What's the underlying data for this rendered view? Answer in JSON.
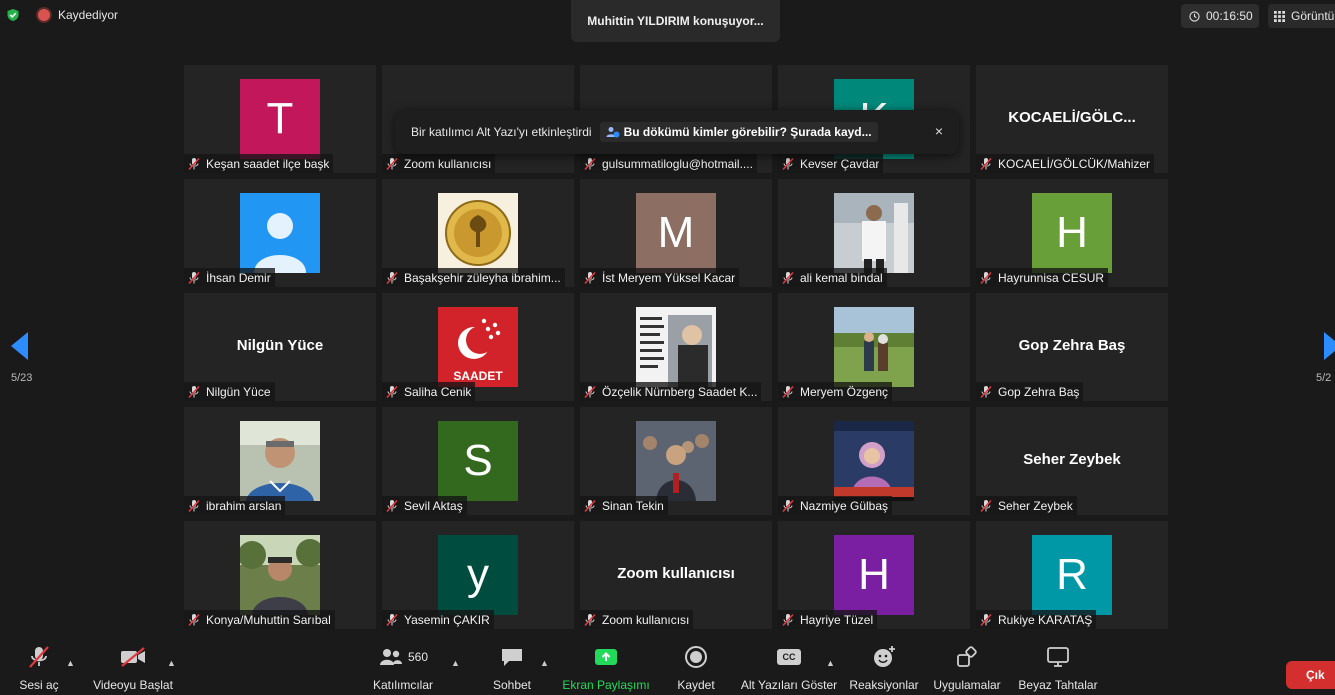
{
  "topbar": {
    "recording_label": "Kaydediyor",
    "speaker": "Muhittin YILDIRIM konuşuyor...",
    "timer": "00:16:50",
    "view_label": "Görüntü"
  },
  "toast": {
    "message": "Bir katılımcı Alt Yazı'yı etkinleştirdi",
    "link": "Bu dökümü kimler görebilir? Şurada kayd...",
    "close": "×"
  },
  "pagination": {
    "left": "5/23",
    "right": "5/2"
  },
  "colors": {
    "recording": "#d9534f",
    "share_green": "#23d959",
    "leave_red": "#d32f2f",
    "muted_red": "#e0383e"
  },
  "tiles": [
    {
      "name": "Keşan saadet ilçe başk",
      "initial": "T",
      "color": "#c2185b"
    },
    {
      "name": "Zoom kullanıcısı",
      "bigname": "Zoom kullanıcısı"
    },
    {
      "name": "gulsummatiloglu@hotmail....",
      "bigname": "gulsummatiloglu"
    },
    {
      "name": "Kevser Çavdar",
      "initial": "K",
      "color": "#00897b"
    },
    {
      "name": "KOCAELİ/GÖLCÜK/Mahizer",
      "bigname": "KOCAELİ/GÖLC..."
    },
    {
      "name": "İhsan Demir",
      "avatar": "default-avatar"
    },
    {
      "name": "Başakşehir züleyha ibrahim...",
      "avatar": "mpac-logo"
    },
    {
      "name": "İst Meryem Yüksel Kacar",
      "initial": "M",
      "color": "#8d6e63"
    },
    {
      "name": "ali kemal bindal",
      "avatar": "photo-person"
    },
    {
      "name": "Hayrunnisa CESUR",
      "initial": "H",
      "color": "#689f38"
    },
    {
      "name": "Nilgün Yüce",
      "bigname": "Nilgün Yüce"
    },
    {
      "name": "Saliha Cenik",
      "avatar": "saadet-logo",
      "logo_text": "SAADET"
    },
    {
      "name": "Özçelik Nürnberg Saadet K...",
      "avatar": "quote-photo"
    },
    {
      "name": "Meryem Özgenç",
      "avatar": "photo-outdoor"
    },
    {
      "name": "Gop Zehra Baş",
      "bigname": "Gop Zehra Baş"
    },
    {
      "name": "ibrahim arslan",
      "avatar": "photo-man"
    },
    {
      "name": "Sevil Aktaş",
      "initial": "S",
      "color": "#33691e"
    },
    {
      "name": "Sinan Tekin",
      "avatar": "photo-crowd"
    },
    {
      "name": "Nazmiye Gülbaş",
      "avatar": "photo-tv"
    },
    {
      "name": "Seher Zeybek",
      "bigname": "Seher Zeybek"
    },
    {
      "name": "Konya/Muhuttin Sarıbal",
      "avatar": "photo-man-trees"
    },
    {
      "name": "Yasemin ÇAKIR",
      "initial": "y",
      "color": "#004d40"
    },
    {
      "name": "Zoom kullanıcısı",
      "bigname": "Zoom kullanıcısı"
    },
    {
      "name": "Hayriye Tüzel",
      "initial": "H",
      "color": "#7b1fa2"
    },
    {
      "name": "Rukiye KARATAŞ",
      "initial": "R",
      "color": "#0097a7"
    }
  ],
  "toolbar": {
    "unmute": "Sesi aç",
    "start_video": "Videoyu Başlat",
    "participants": "Katılımcılar",
    "participants_count": "560",
    "chat": "Sohbet",
    "share": "Ekran Paylaşımı",
    "record": "Kaydet",
    "captions": "Alt Yazıları Göster",
    "captions_badge": "CC",
    "reactions": "Reaksiyonlar",
    "apps": "Uygulamalar",
    "whiteboards": "Beyaz Tahtalar",
    "leave": "Çık"
  }
}
